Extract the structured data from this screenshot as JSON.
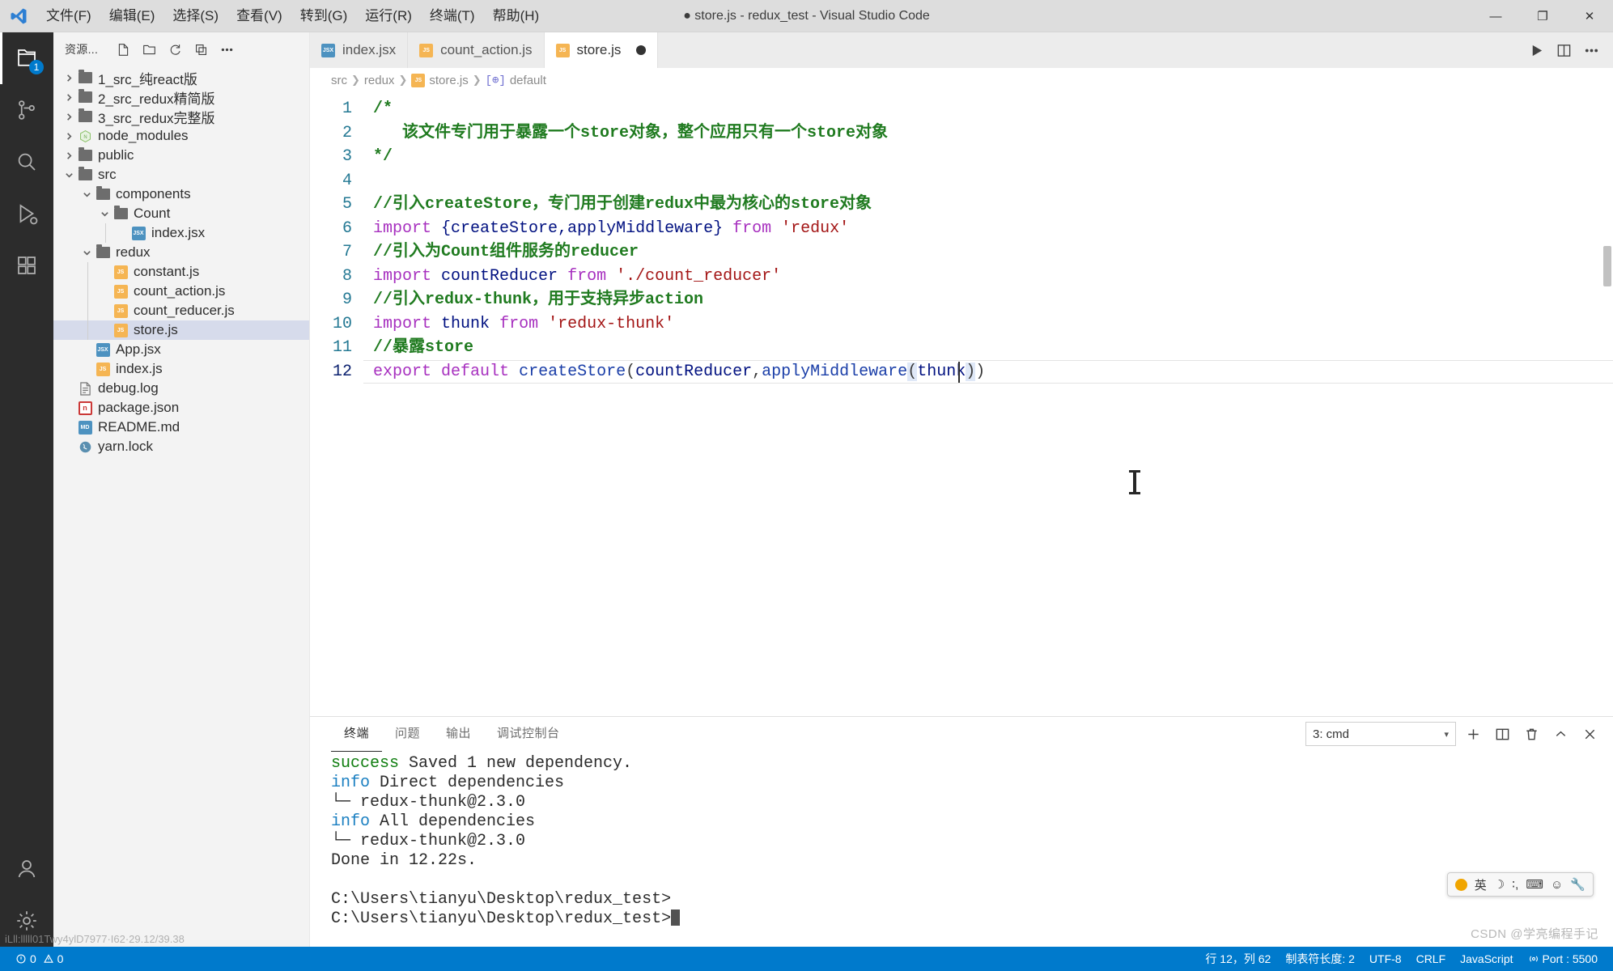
{
  "window": {
    "title": "● store.js - redux_test - Visual Studio Code",
    "minimize": "—",
    "maximize": "❐",
    "close": "✕"
  },
  "menu": {
    "items": [
      {
        "label": "文件(F)"
      },
      {
        "label": "编辑(E)"
      },
      {
        "label": "选择(S)"
      },
      {
        "label": "查看(V)"
      },
      {
        "label": "转到(G)"
      },
      {
        "label": "运行(R)"
      },
      {
        "label": "终端(T)"
      },
      {
        "label": "帮助(H)"
      }
    ]
  },
  "activitybar": {
    "items": [
      {
        "name": "explorer",
        "badge": "1"
      },
      {
        "name": "source-control",
        "badge": ""
      },
      {
        "name": "search",
        "badge": ""
      },
      {
        "name": "run-and-debug",
        "badge": ""
      },
      {
        "name": "extensions",
        "badge": ""
      }
    ],
    "bottom": [
      {
        "name": "accounts"
      },
      {
        "name": "settings"
      }
    ]
  },
  "sidebar": {
    "title": "资源...",
    "actions": [
      "new-file",
      "new-folder",
      "refresh",
      "collapse-all",
      "more"
    ],
    "tree": [
      {
        "label": "1_src_纯react版",
        "depth": 0,
        "type": "folder",
        "state": "collapsed"
      },
      {
        "label": "2_src_redux精简版",
        "depth": 0,
        "type": "folder",
        "state": "collapsed"
      },
      {
        "label": "3_src_redux完整版",
        "depth": 0,
        "type": "folder",
        "state": "collapsed"
      },
      {
        "label": "node_modules",
        "depth": 0,
        "type": "node",
        "state": "collapsed"
      },
      {
        "label": "public",
        "depth": 0,
        "type": "folder",
        "state": "collapsed"
      },
      {
        "label": "src",
        "depth": 0,
        "type": "folder",
        "state": "expanded"
      },
      {
        "label": "components",
        "depth": 1,
        "type": "folder",
        "state": "expanded"
      },
      {
        "label": "Count",
        "depth": 2,
        "type": "folder",
        "state": "expanded"
      },
      {
        "label": "index.jsx",
        "depth": 3,
        "type": "jsx"
      },
      {
        "label": "redux",
        "depth": 1,
        "type": "folder",
        "state": "expanded"
      },
      {
        "label": "constant.js",
        "depth": 2,
        "type": "js"
      },
      {
        "label": "count_action.js",
        "depth": 2,
        "type": "js"
      },
      {
        "label": "count_reducer.js",
        "depth": 2,
        "type": "js"
      },
      {
        "label": "store.js",
        "depth": 2,
        "type": "js",
        "selected": true
      },
      {
        "label": "App.jsx",
        "depth": 1,
        "type": "jsx"
      },
      {
        "label": "index.js",
        "depth": 1,
        "type": "js"
      },
      {
        "label": "debug.log",
        "depth": 0,
        "type": "log"
      },
      {
        "label": "package.json",
        "depth": 0,
        "type": "npm"
      },
      {
        "label": "README.md",
        "depth": 0,
        "type": "md"
      },
      {
        "label": "yarn.lock",
        "depth": 0,
        "type": "yarn"
      }
    ]
  },
  "editor": {
    "tabs": [
      {
        "label": "index.jsx",
        "type": "jsx",
        "active": false,
        "dirty": false
      },
      {
        "label": "count_action.js",
        "type": "js",
        "active": false,
        "dirty": false
      },
      {
        "label": "store.js",
        "type": "js",
        "active": true,
        "dirty": true
      }
    ],
    "tab_actions": [
      "run-file",
      "split-editor",
      "more-actions"
    ],
    "breadcrumb": [
      "src",
      "redux",
      "store.js",
      "default"
    ],
    "breadcrumb_symbol_icon": "[⊕]",
    "line_numbers": [
      "1",
      "2",
      "3",
      "4",
      "5",
      "6",
      "7",
      "8",
      "9",
      "10",
      "11",
      "12"
    ],
    "current_line": 12,
    "lines": [
      {
        "n": "1",
        "tokens": [
          {
            "t": "/*",
            "c": "com"
          }
        ]
      },
      {
        "n": "2",
        "tokens": [
          {
            "t": "   该文件专门用于暴露一个store对象，整个应用只有一个store对象",
            "c": "com"
          }
        ]
      },
      {
        "n": "3",
        "tokens": [
          {
            "t": "*/",
            "c": "com"
          }
        ]
      },
      {
        "n": "4",
        "tokens": [
          {
            "t": "",
            "c": "pun"
          }
        ]
      },
      {
        "n": "5",
        "tokens": [
          {
            "t": "//引入createStore，专门用于创建redux中最为核心的store对象",
            "c": "com"
          }
        ]
      },
      {
        "n": "6",
        "tokens": [
          {
            "t": "import",
            "c": "kw"
          },
          {
            "t": " ",
            "c": "pun"
          },
          {
            "t": "{createStore,applyMiddleware}",
            "c": "id"
          },
          {
            "t": " ",
            "c": "pun"
          },
          {
            "t": "from",
            "c": "kw"
          },
          {
            "t": " ",
            "c": "pun"
          },
          {
            "t": "'redux'",
            "c": "str"
          }
        ]
      },
      {
        "n": "7",
        "tokens": [
          {
            "t": "//引入为Count组件服务的reducer",
            "c": "com"
          }
        ]
      },
      {
        "n": "8",
        "tokens": [
          {
            "t": "import",
            "c": "kw"
          },
          {
            "t": " ",
            "c": "pun"
          },
          {
            "t": "countReducer",
            "c": "id"
          },
          {
            "t": " ",
            "c": "pun"
          },
          {
            "t": "from",
            "c": "kw"
          },
          {
            "t": " ",
            "c": "pun"
          },
          {
            "t": "'./count_reducer'",
            "c": "str"
          }
        ]
      },
      {
        "n": "9",
        "tokens": [
          {
            "t": "//引入redux-thunk，用于支持异步action",
            "c": "com"
          }
        ]
      },
      {
        "n": "10",
        "tokens": [
          {
            "t": "import",
            "c": "kw"
          },
          {
            "t": " ",
            "c": "pun"
          },
          {
            "t": "thunk",
            "c": "id"
          },
          {
            "t": " ",
            "c": "pun"
          },
          {
            "t": "from",
            "c": "kw"
          },
          {
            "t": " ",
            "c": "pun"
          },
          {
            "t": "'redux-thunk'",
            "c": "str"
          }
        ]
      },
      {
        "n": "11",
        "tokens": [
          {
            "t": "//暴露store",
            "c": "com"
          }
        ]
      },
      {
        "n": "12",
        "tokens": [
          {
            "t": "export",
            "c": "kw"
          },
          {
            "t": " ",
            "c": "pun"
          },
          {
            "t": "default",
            "c": "kw"
          },
          {
            "t": " ",
            "c": "pun"
          },
          {
            "t": "createStore",
            "c": "fn"
          },
          {
            "t": "(",
            "c": "pun"
          },
          {
            "t": "countReducer",
            "c": "id"
          },
          {
            "t": ",",
            "c": "pun"
          },
          {
            "t": "applyMiddleware",
            "c": "fn"
          },
          {
            "t": "(",
            "c": "sel"
          },
          {
            "t": "thunk",
            "c": "id"
          },
          {
            "t": ")",
            "c": "sel"
          },
          {
            "t": ")",
            "c": "pun"
          }
        ]
      }
    ]
  },
  "panel": {
    "tabs": [
      {
        "label": "终端",
        "active": true
      },
      {
        "label": "问题",
        "active": false
      },
      {
        "label": "输出",
        "active": false
      },
      {
        "label": "调试控制台",
        "active": false
      }
    ],
    "terminal_select": "3: cmd",
    "actions": [
      "new-terminal",
      "split-terminal",
      "kill-terminal",
      "maximize-panel",
      "close-panel"
    ],
    "terminal_lines": [
      [
        {
          "t": "success",
          "c": "green"
        },
        {
          "t": " Saved 1 new dependency.",
          "c": "plain"
        }
      ],
      [
        {
          "t": "info",
          "c": "blue"
        },
        {
          "t": " Direct dependencies",
          "c": "plain"
        }
      ],
      [
        {
          "t": "└─ redux-thunk@2.3.0",
          "c": "plain"
        }
      ],
      [
        {
          "t": "info",
          "c": "blue"
        },
        {
          "t": " All dependencies",
          "c": "plain"
        }
      ],
      [
        {
          "t": "└─ redux-thunk@2.3.0",
          "c": "plain"
        }
      ],
      [
        {
          "t": "Done in 12.22s.",
          "c": "plain"
        }
      ],
      [
        {
          "t": "",
          "c": "plain"
        }
      ],
      [
        {
          "t": "C:\\Users\\tianyu\\Desktop\\redux_test>",
          "c": "plain"
        }
      ],
      [
        {
          "t": "C:\\Users\\tianyu\\Desktop\\redux_test>",
          "c": "plain",
          "caret": true
        }
      ]
    ]
  },
  "ime": {
    "mode": "英",
    "items": [
      "☽",
      "∶,",
      "⌨",
      "☺",
      "🔧"
    ]
  },
  "statusbar": {
    "left": [
      {
        "label": "0",
        "icon": "error-icon"
      },
      {
        "label": "0",
        "icon": "warning-icon"
      }
    ],
    "right": [
      {
        "label": "行 12，列 62"
      },
      {
        "label": "制表符长度: 2"
      },
      {
        "label": "UTF-8"
      },
      {
        "label": "CRLF"
      },
      {
        "label": "JavaScript"
      },
      {
        "label": "Port : 5500",
        "icon": "broadcast-icon"
      }
    ]
  },
  "watermarks": {
    "right": "CSDN @学亮编程手记",
    "left": "iLll:lllll01Twy4ylD7977·I62·29.12/39.38"
  },
  "colors": {
    "accent": "#007acc",
    "titlebar": "#dddddd",
    "activitybar": "#2c2c2c",
    "sidebar": "#f3f3f3",
    "editor": "#ffffff",
    "selection": "#d6dbeb",
    "comment": "#207b20",
    "keyword": "#a730bf",
    "string": "#a31515",
    "identifier": "#001080",
    "linenumber": "#237893"
  }
}
